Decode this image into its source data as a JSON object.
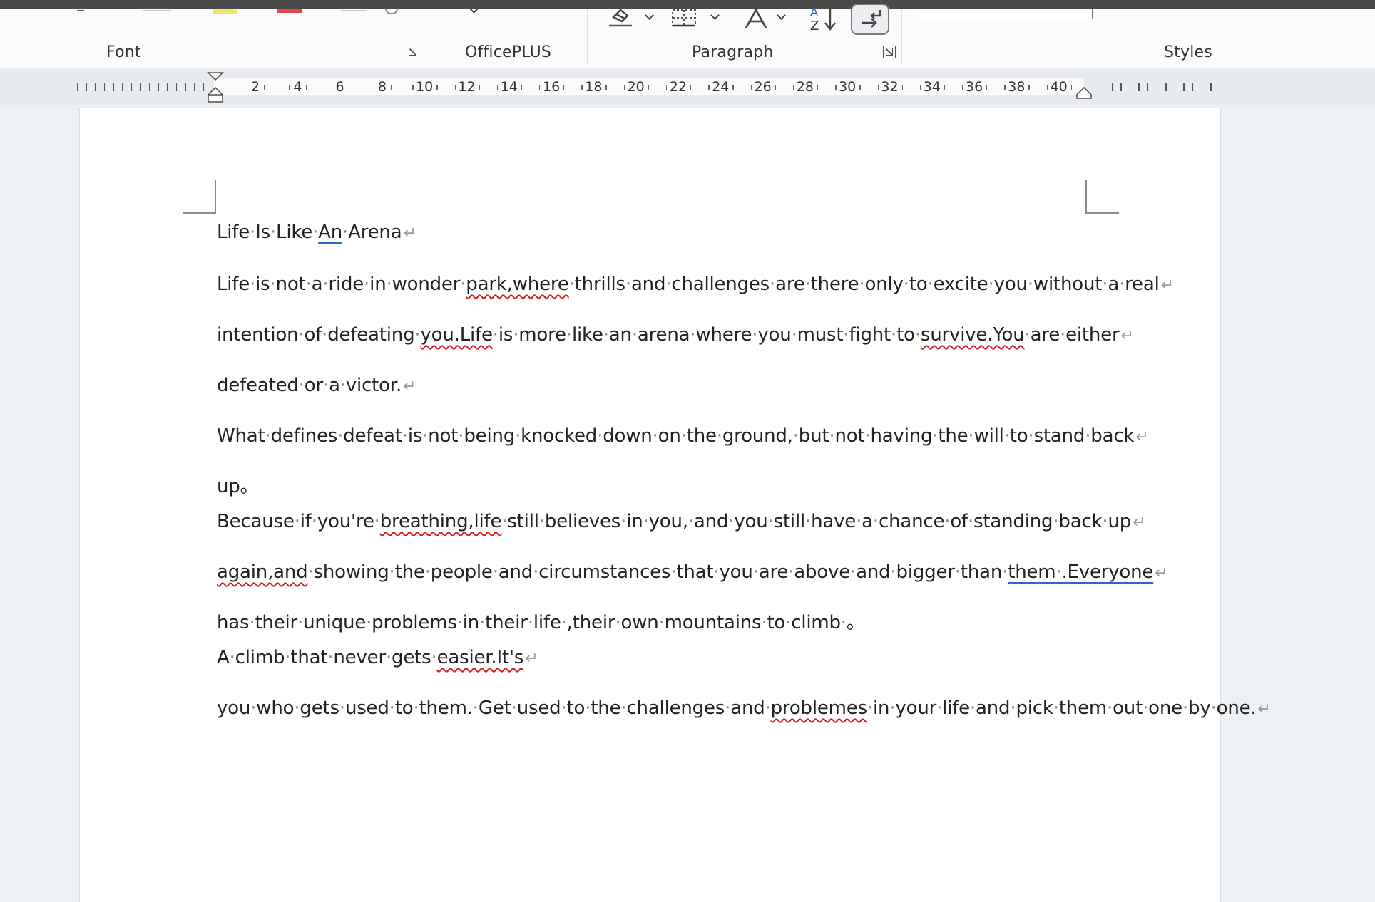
{
  "ribbon": {
    "groups": [
      {
        "label": "Font"
      },
      {
        "label": "OfficePLUS"
      },
      {
        "label": "Paragraph"
      },
      {
        "label": "Styles"
      }
    ]
  },
  "ruler": {
    "numbers": [
      "2",
      "4",
      "6",
      "8",
      "10",
      "12",
      "14",
      "16",
      "18",
      "20",
      "22",
      "24",
      "26",
      "28",
      "30",
      "32",
      "34",
      "36",
      "38",
      "40"
    ]
  },
  "document": {
    "paragraphs": [
      {
        "text": "Life Is Like An Arena"
      },
      {
        "text": "Life is not a ride in wonder park,where thrills and challenges are there only to excite you without a real"
      },
      {
        "text": "intention of defeating you.Life is more like an arena where you must fight to survive.You are either"
      },
      {
        "text": "defeated or a victor."
      },
      {
        "text": "What defines defeat is not being knocked down on the ground, but not having the will to stand back"
      },
      {
        "text": "up。Because if you're breathing,life still believes in you, and you still have a chance of standing back up"
      },
      {
        "text": "again,and showing the people and circumstances that you are above and bigger than them .Everyone"
      },
      {
        "text": "has their unique problems in their life ,their own mountains to climb 。A climb that never gets easier.It's"
      },
      {
        "text": "you who gets used to them. Get used to the challenges and problemes in your life and pick them out one by one."
      }
    ]
  },
  "colors": {
    "spelling_error": "#d42020",
    "grammar_underline": "#2f66c9",
    "page": "#ffffff",
    "canvas": "#eef1f4"
  },
  "icons": [
    "eraser-icon",
    "borders-icon",
    "line-spacing-icon",
    "sort-icon",
    "show-formatting-icon",
    "dialog-launcher-icon"
  ]
}
